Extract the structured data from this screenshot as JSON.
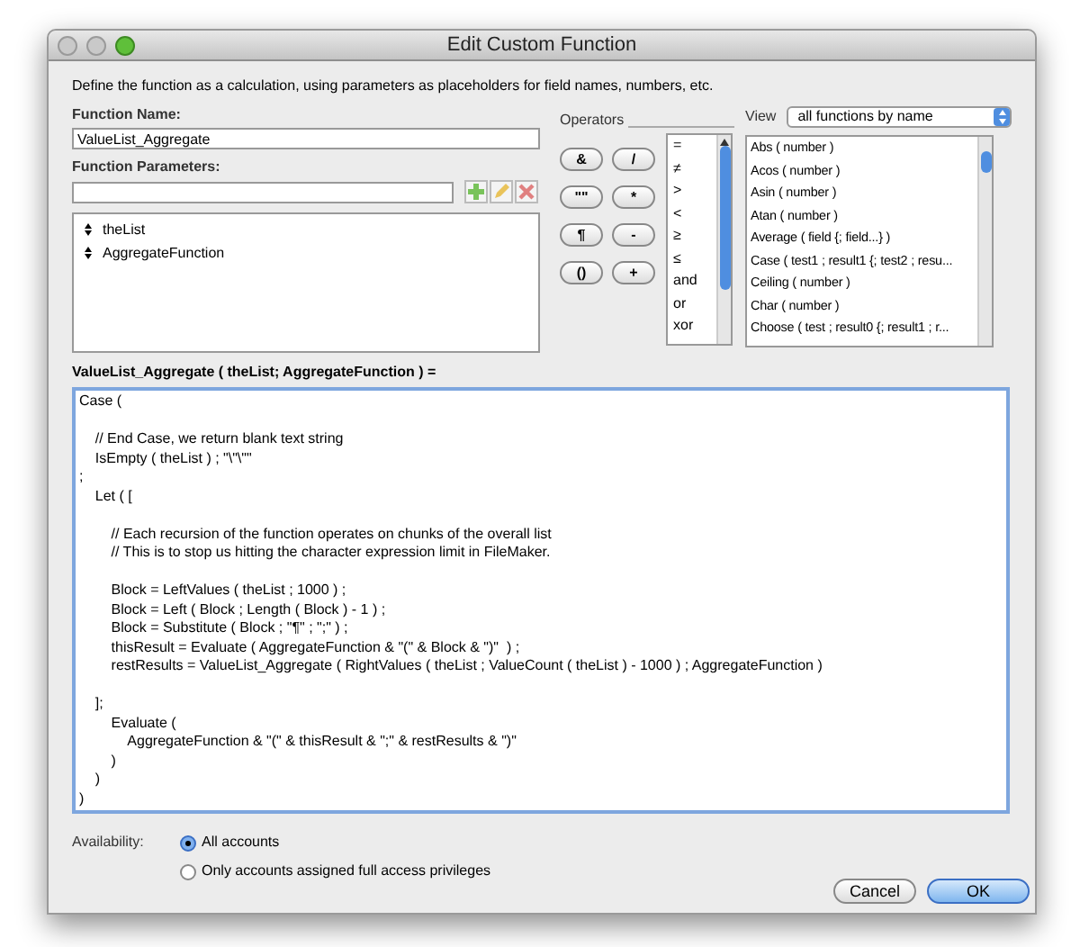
{
  "window": {
    "title": "Edit Custom Function"
  },
  "description": "Define the function as a calculation, using parameters as placeholders for field names, numbers, etc.",
  "function_name": {
    "label": "Function Name:",
    "value": "ValueList_Aggregate"
  },
  "parameters": {
    "label": "Function Parameters:",
    "items": [
      "theList",
      "AggregateFunction"
    ]
  },
  "operators": {
    "label": "Operators",
    "buttons": [
      "&",
      "/",
      "\"\"",
      "*",
      "¶",
      "-",
      "()",
      "+"
    ],
    "list": [
      "=",
      "≠",
      ">",
      "<",
      "≥",
      "≤",
      "and",
      "or",
      "xor"
    ]
  },
  "view": {
    "label": "View",
    "selected": "all functions by name"
  },
  "functions": [
    "Abs ( number )",
    "Acos ( number )",
    "Asin ( number )",
    "Atan ( number )",
    "Average ( field {; field...} )",
    "Case ( test1 ; result1 {; test2 ; resu...",
    "Ceiling ( number )",
    "Char ( number )",
    "Choose ( test ; result0 {; result1 ; r..."
  ],
  "formula": {
    "header": "ValueList_Aggregate ( theList; AggregateFunction ) =",
    "value": "Case (\n\n\t// End Case, we return blank text string\n\tIsEmpty ( theList ) ; \"\\\"\\\"\"\n;\n\tLet ( [\n\n\t\t// Each recursion of the function operates on chunks of the overall list\n\t\t// This is to stop us hitting the character expression limit in FileMaker.\n\n\t\tBlock = LeftValues ( theList ; 1000 ) ;\n\t\tBlock = Left ( Block ; Length ( Block ) - 1 ) ;\n\t\tBlock = Substitute ( Block ; \"¶\" ; \";\" ) ;\n\t\tthisResult = Evaluate ( AggregateFunction & \"(\" & Block & \")\"  ) ;\n\t\trestResults = ValueList_Aggregate ( RightValues ( theList ; ValueCount ( theList ) - 1000 ) ; AggregateFunction )\n\n\t];\n\t\tEvaluate (\n\t\t\tAggregateFunction & \"(\" & thisResult & \";\" & restResults & \")\"\n\t\t)\n\t)\n)"
  },
  "availability": {
    "label": "Availability:",
    "options": [
      {
        "label": "All accounts",
        "selected": true
      },
      {
        "label": "Only accounts assigned full access privileges",
        "selected": false
      }
    ]
  },
  "buttons": [
    {
      "label": "Cancel",
      "kind": "secondary"
    },
    {
      "label": "OK",
      "kind": "default"
    }
  ]
}
